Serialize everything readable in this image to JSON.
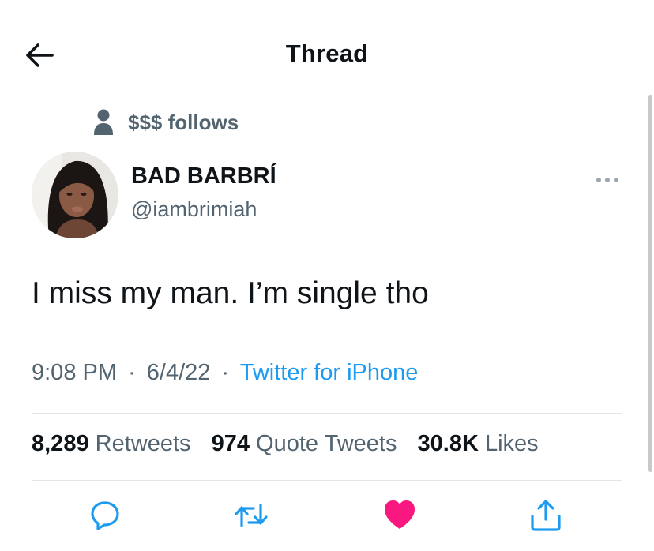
{
  "header": {
    "title": "Thread"
  },
  "social_context": {
    "text": "$$$ follows"
  },
  "author": {
    "name": "BAD BARBRÍ",
    "handle": "@iambrimiah"
  },
  "tweet": {
    "text": "I miss my man. I’m single tho"
  },
  "meta": {
    "time": "9:08 PM",
    "date": "6/4/22",
    "source": "Twitter for iPhone",
    "separator": "·"
  },
  "stats": [
    {
      "value": "8,289",
      "label": "Retweets"
    },
    {
      "value": "974",
      "label": "Quote Tweets"
    },
    {
      "value": "30.8K",
      "label": "Likes"
    }
  ],
  "colors": {
    "accent": "#1d9bf0",
    "like": "#f91880",
    "text": "#0f1419",
    "muted": "#536471"
  },
  "icons": {
    "back": "arrow-left-icon",
    "social": "person-icon",
    "more": "more-horizontal-icon",
    "reply": "reply-icon",
    "retweet": "retweet-icon",
    "like": "heart-filled-icon",
    "share": "share-icon"
  }
}
